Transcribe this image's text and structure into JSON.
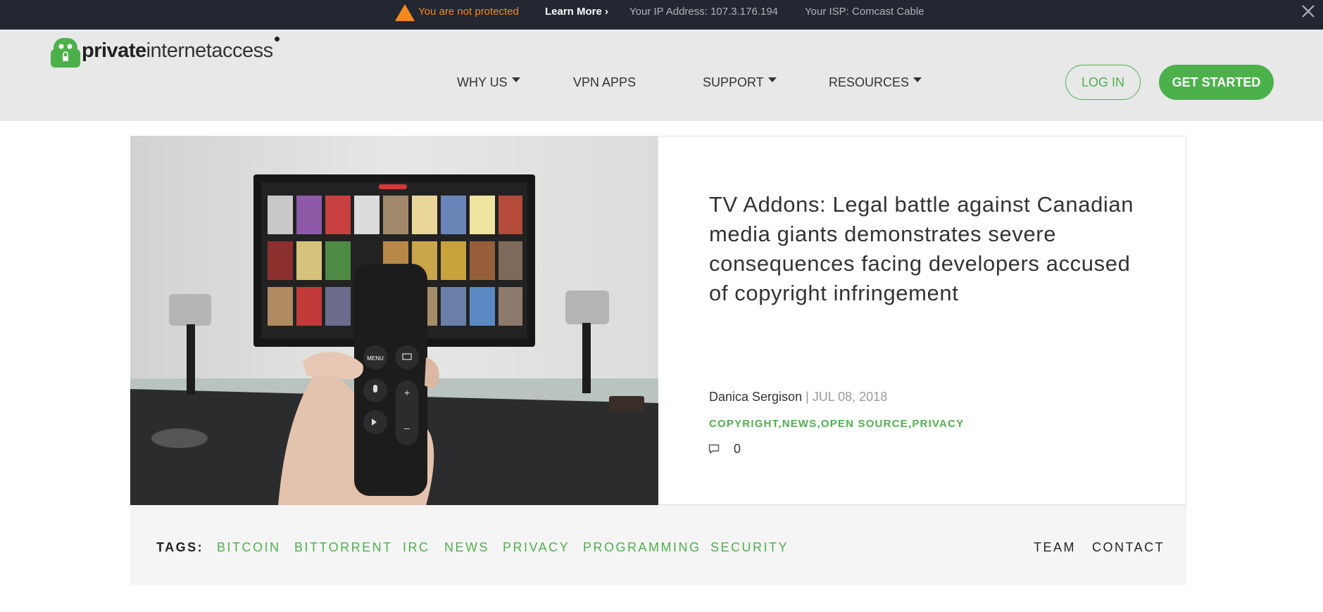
{
  "alert_bar": {
    "status_text": "You are not protected",
    "learn_more": "Learn More ›",
    "ip_text": "Your IP Address: 107.3.176.194",
    "isp_text": "Your ISP: Comcast Cable",
    "warning_color": "#f5891f"
  },
  "header": {
    "logo_bold": "private",
    "logo_light": "internetaccess",
    "nav": [
      {
        "label": "WHY US",
        "has_dropdown": true
      },
      {
        "label": "VPN APPS",
        "has_dropdown": false
      },
      {
        "label": "SUPPORT",
        "has_dropdown": true
      },
      {
        "label": "RESOURCES",
        "has_dropdown": true
      }
    ],
    "login_label": "LOG IN",
    "get_started_label": "GET STARTED",
    "accent_color": "#4cb14a"
  },
  "article": {
    "title": "TV Addons: Legal battle against Canadian media giants demonstrates severe consequences facing developers accused of copyright infringement",
    "author": "Danica Sergison",
    "separator": "|",
    "date": "JUL 08, 2018",
    "categories": [
      "COPYRIGHT",
      "NEWS",
      "OPEN SOURCE",
      "PRIVACY"
    ],
    "comment_count": "0",
    "remote_buttons": {
      "menu": "MENU"
    }
  },
  "footer_tags": {
    "label": "TAGS:",
    "tags": [
      "BITCOIN",
      "BITTORRENT",
      "IRC",
      "NEWS",
      "PRIVACY",
      "PROGRAMMING",
      "SECURITY"
    ],
    "team": "TEAM",
    "contact": "CONTACT"
  }
}
